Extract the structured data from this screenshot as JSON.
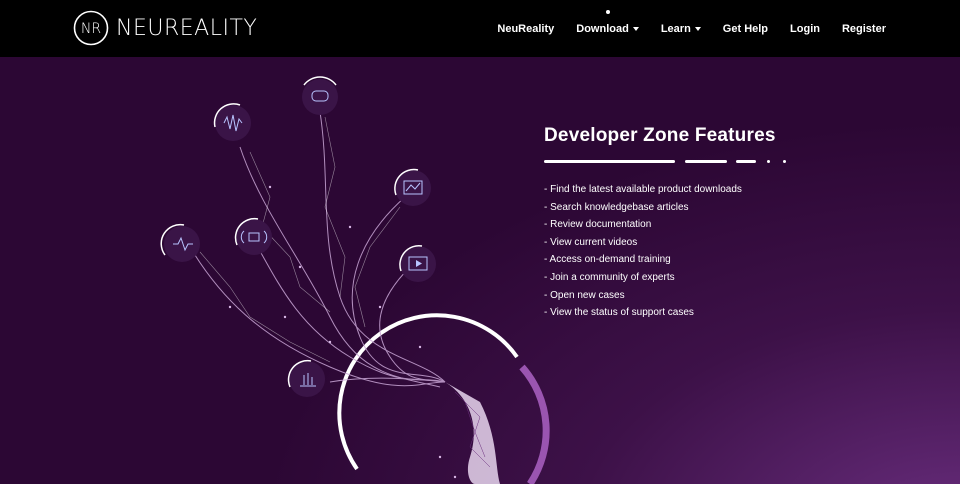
{
  "brand": {
    "logo_mark": "NR",
    "logo_text": "NEUREALITY"
  },
  "nav": {
    "items": [
      {
        "label": "NeuReality",
        "has_caret": false
      },
      {
        "label": "Download",
        "has_caret": true,
        "active": true
      },
      {
        "label": "Learn",
        "has_caret": true
      },
      {
        "label": "Get Help",
        "has_caret": false
      },
      {
        "label": "Login",
        "has_caret": false
      },
      {
        "label": "Register",
        "has_caret": false
      }
    ]
  },
  "hero": {
    "icons": [
      "cloud-data-icon",
      "sound-wave-icon",
      "image-chart-icon",
      "broadcast-icon",
      "heart-monitor-icon",
      "video-play-icon",
      "touch-icon"
    ]
  },
  "features": {
    "title": "Developer Zone Features",
    "items": [
      "- Find the latest available product downloads",
      "- Search knowledgebase articles",
      "- Review documentation",
      "- View current videos",
      "- Access on-demand training",
      "- Join a community of experts",
      "- Open new cases",
      "- View the status of support cases"
    ]
  },
  "colors": {
    "topbar": "#000000",
    "hero_dark": "#2c0734",
    "hero_light": "#6a2e7f",
    "text": "#ffffff",
    "accent_purple": "#8a4a9e"
  }
}
